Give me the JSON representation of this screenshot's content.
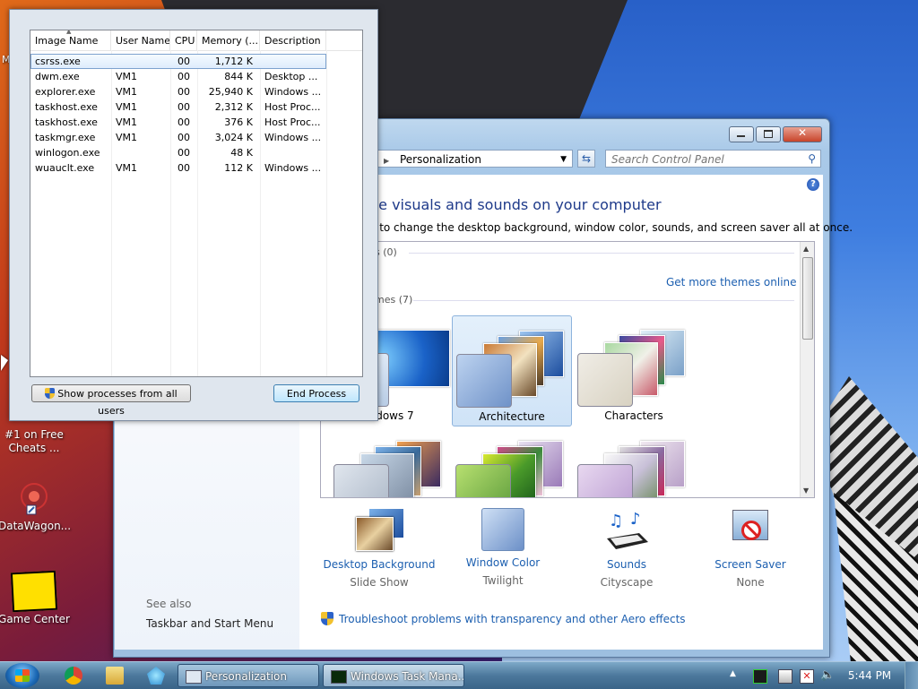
{
  "colors": {
    "accent": "#1c5fb0",
    "heading": "#1e3a8a",
    "selection": "#cfe3f7"
  },
  "desktop_icons": [
    {
      "name": "desk-icon-free-cheats",
      "label": "#1 on Free Cheats ..."
    },
    {
      "name": "desk-icon-datawagon",
      "label": "DataWagon..."
    },
    {
      "name": "desk-icon-game-center",
      "label": "Game Center"
    }
  ],
  "desktop_left_label": "M",
  "control_panel": {
    "address": "Personalization",
    "search_placeholder": "Search Control Panel",
    "heading": "he visuals and sounds on your computer",
    "subheading": "e to change the desktop background, window color, sounds, and screen saver all at once.",
    "my_themes_label": "s (0)",
    "get_more_online": "Get more themes online",
    "aero_themes_label": "mes (7)",
    "themes": [
      {
        "name": "indows 7",
        "selected": false
      },
      {
        "name": "Architecture",
        "selected": true
      },
      {
        "name": "Characters",
        "selected": false
      },
      {
        "name": "",
        "selected": false
      },
      {
        "name": "",
        "selected": false
      },
      {
        "name": "",
        "selected": false
      }
    ],
    "bottom": [
      {
        "title": "Desktop Background",
        "sub": "Slide Show"
      },
      {
        "title": "Window Color",
        "sub": "Twilight"
      },
      {
        "title": "Sounds",
        "sub": "Cityscape"
      },
      {
        "title": "Screen Saver",
        "sub": "None"
      }
    ],
    "see_also": "See also",
    "taskbar_link": "Taskbar and Start Menu",
    "troubleshoot": "Troubleshoot problems with transparency and other Aero effects",
    "help": "?"
  },
  "task_manager": {
    "columns": [
      "Image Name",
      "User Name",
      "CPU",
      "Memory (...",
      "Description"
    ],
    "rows": [
      {
        "image": "csrss.exe",
        "user": "",
        "cpu": "00",
        "mem": "1,712 K",
        "desc": ""
      },
      {
        "image": "dwm.exe",
        "user": "VM1",
        "cpu": "00",
        "mem": "844 K",
        "desc": "Desktop ..."
      },
      {
        "image": "explorer.exe",
        "user": "VM1",
        "cpu": "00",
        "mem": "25,940 K",
        "desc": "Windows ..."
      },
      {
        "image": "taskhost.exe",
        "user": "VM1",
        "cpu": "00",
        "mem": "2,312 K",
        "desc": "Host Proc..."
      },
      {
        "image": "taskhost.exe",
        "user": "VM1",
        "cpu": "00",
        "mem": "376 K",
        "desc": "Host Proc..."
      },
      {
        "image": "taskmgr.exe",
        "user": "VM1",
        "cpu": "00",
        "mem": "3,024 K",
        "desc": "Windows ..."
      },
      {
        "image": "winlogon.exe",
        "user": "",
        "cpu": "00",
        "mem": "48 K",
        "desc": ""
      },
      {
        "image": "wuauclt.exe",
        "user": "VM1",
        "cpu": "00",
        "mem": "112 K",
        "desc": "Windows ..."
      }
    ],
    "show_all_button": "Show processes from all users",
    "end_process_button": "End Process"
  },
  "taskbar": {
    "tasks": [
      {
        "label": "Personalization",
        "active": false
      },
      {
        "label": "Windows Task Mana...",
        "active": true
      }
    ],
    "clock": "5:44 PM"
  }
}
